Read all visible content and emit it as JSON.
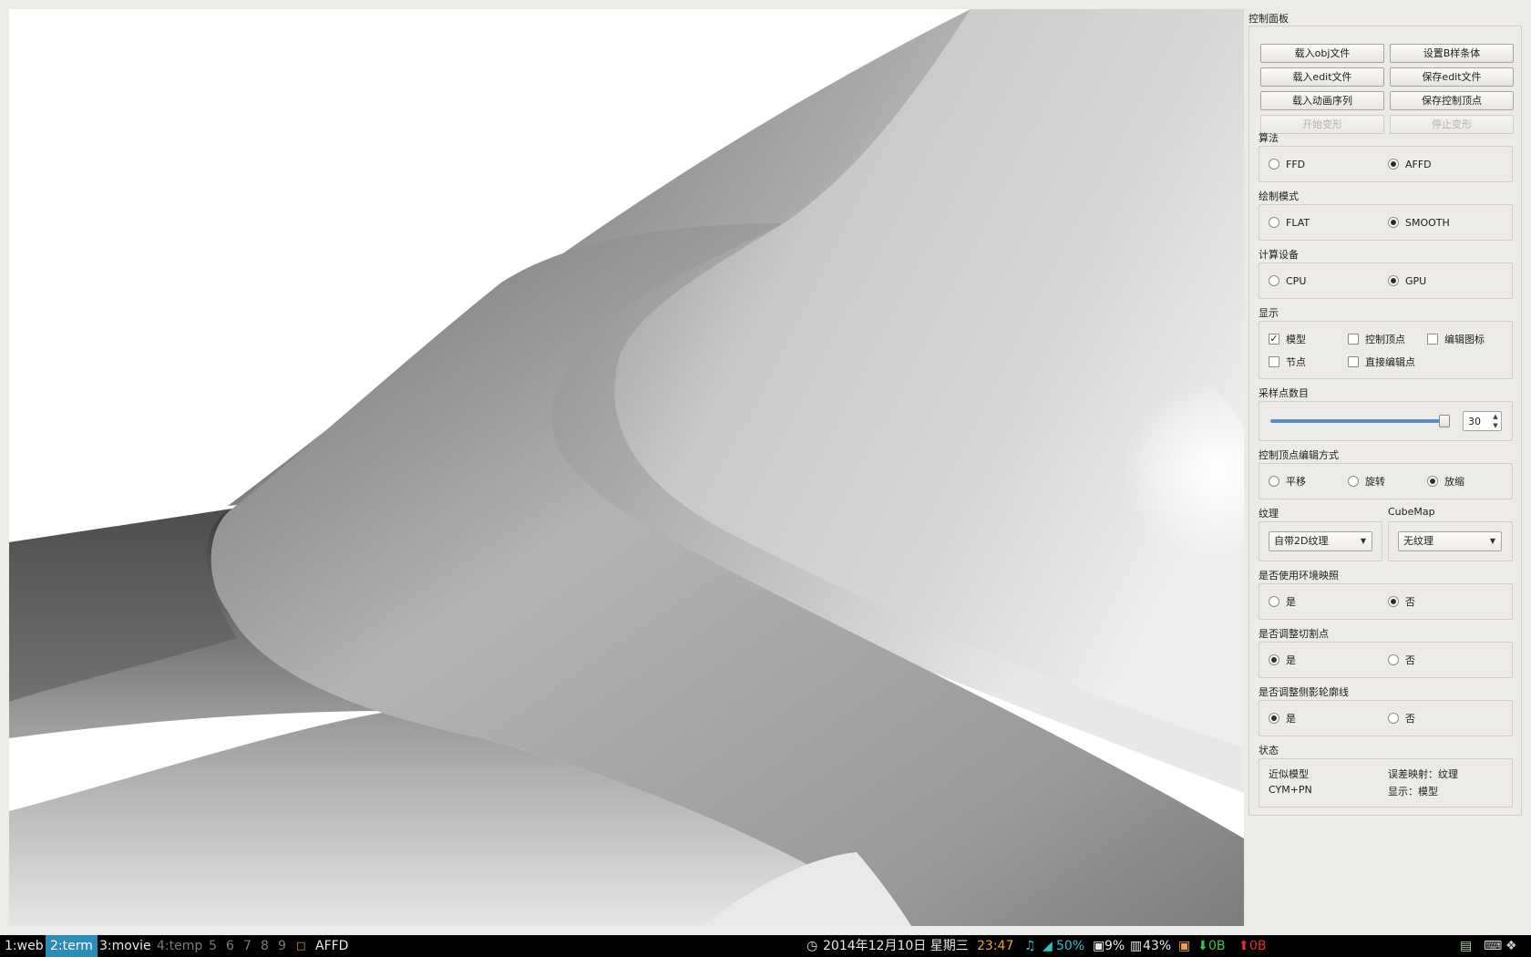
{
  "panel": {
    "title": "控制面板",
    "buttons": [
      {
        "label": "载入obj文件",
        "enabled": true
      },
      {
        "label": "设置B样条体",
        "enabled": true
      },
      {
        "label": "载入edit文件",
        "enabled": true
      },
      {
        "label": "保存edit文件",
        "enabled": true
      },
      {
        "label": "载入动画序列",
        "enabled": true
      },
      {
        "label": "保存控制顶点",
        "enabled": true
      },
      {
        "label": "开始变形",
        "enabled": false
      },
      {
        "label": "停止变形",
        "enabled": false
      }
    ],
    "algorithm": {
      "title": "算法",
      "options": [
        "FFD",
        "AFFD"
      ],
      "selected": "AFFD"
    },
    "draw_mode": {
      "title": "绘制模式",
      "options": [
        "FLAT",
        "SMOOTH"
      ],
      "selected": "SMOOTH"
    },
    "compute_device": {
      "title": "计算设备",
      "options": [
        "CPU",
        "GPU"
      ],
      "selected": "GPU"
    },
    "display": {
      "title": "显示",
      "options": [
        {
          "label": "模型",
          "checked": true
        },
        {
          "label": "控制顶点",
          "checked": false
        },
        {
          "label": "编辑图标",
          "checked": false
        },
        {
          "label": "节点",
          "checked": false
        },
        {
          "label": "直接编辑点",
          "checked": false
        }
      ]
    },
    "samples": {
      "title": "采样点数目",
      "value": "30",
      "slider_fraction": 1.0
    },
    "edit_mode": {
      "title": "控制顶点编辑方式",
      "options": [
        "平移",
        "旋转",
        "放缩"
      ],
      "selected": "放缩"
    },
    "texture": {
      "title": "纹理",
      "value": "自带2D纹理"
    },
    "cubemap": {
      "title": "CubeMap",
      "value": "无纹理"
    },
    "env_map": {
      "title": "是否使用环境映照",
      "options": [
        "是",
        "否"
      ],
      "selected": "否"
    },
    "cut_points": {
      "title": "是否调整切割点",
      "options": [
        "是",
        "否"
      ],
      "selected": "是"
    },
    "silhouette": {
      "title": "是否调整侧影轮廓线",
      "options": [
        "是",
        "否"
      ],
      "selected": "是"
    },
    "status": {
      "title": "状态",
      "items": [
        "近似模型",
        "误差映射：纹理",
        "CYM+PN",
        "显示：模型"
      ]
    }
  },
  "taskbar": {
    "workspaces": [
      {
        "label": "1:web",
        "state": "normal"
      },
      {
        "label": "2:term",
        "state": "active"
      },
      {
        "label": "3:movie",
        "state": "normal"
      },
      {
        "label": "4:temp",
        "state": "dim"
      },
      {
        "label": "5",
        "state": "dim"
      },
      {
        "label": "6",
        "state": "dim"
      },
      {
        "label": "7",
        "state": "dim"
      },
      {
        "label": "8",
        "state": "dim"
      },
      {
        "label": "9",
        "state": "dim"
      }
    ],
    "window_title": "AFFD",
    "date": "2014年12月10日 星期三",
    "time": "23:47",
    "volume": "50%",
    "cpu": "9%",
    "mem": "43%",
    "net_down": "0B",
    "net_up": "0B",
    "colors": {
      "active_ws": "#2b8cb6",
      "time": "#e8a33c",
      "volume": "#2bc3c9",
      "net_down": "#3cc43c",
      "net_up": "#e03030"
    }
  }
}
